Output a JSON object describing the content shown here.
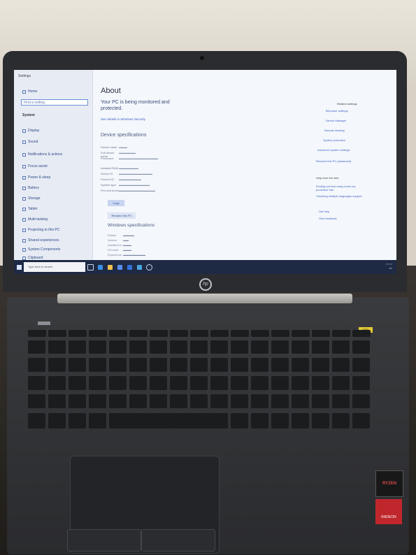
{
  "sidebar": {
    "window_title": "Settings",
    "home": "Home",
    "search_placeholder": "Find a setting",
    "section": "System",
    "items": [
      "Display",
      "Sound",
      "Notifications & actions",
      "Focus assist",
      "Power & sleep",
      "Battery",
      "Storage",
      "Tablet",
      "Multi-tasking",
      "Projecting to this PC",
      "Shared experiences",
      "System Components",
      "Clipboard"
    ]
  },
  "main": {
    "title": "About",
    "monitored": "Your PC is being monitored and protected.",
    "security_link": "See details in Windows Security",
    "device_specs_title": "Device specifications",
    "spec_labels": [
      "Device name",
      "Full device name",
      "Processor",
      "Installed RAM",
      "Device ID",
      "Product ID",
      "System type",
      "Pen and touch"
    ],
    "copy_button": "Copy",
    "rename_button": "Rename this PC",
    "windows_specs_title": "Windows specifications",
    "win_labels": [
      "Edition",
      "Version",
      "Installed on",
      "OS build",
      "Experience"
    ]
  },
  "right_links": [
    "Related settings",
    "BitLocker settings",
    "Device Manager",
    "Remote desktop",
    "System protection",
    "Advanced system settings",
    "Rename this PC (advanced)",
    "Help from the web",
    "Finding out how many cores my processor has",
    "Checking multiple languages support",
    "Get help",
    "Give feedback"
  ],
  "taskbar": {
    "search": "Type here to search"
  },
  "keyboard": {
    "sticker_text": "SSD"
  },
  "badges": {
    "ryzen": "RYZEN",
    "radeon": "RADEON"
  },
  "colors": {
    "accent": "#3d64c8",
    "taskbar": "#1e2a44",
    "radeon": "#c0272d",
    "sticker": "#e2c833"
  }
}
